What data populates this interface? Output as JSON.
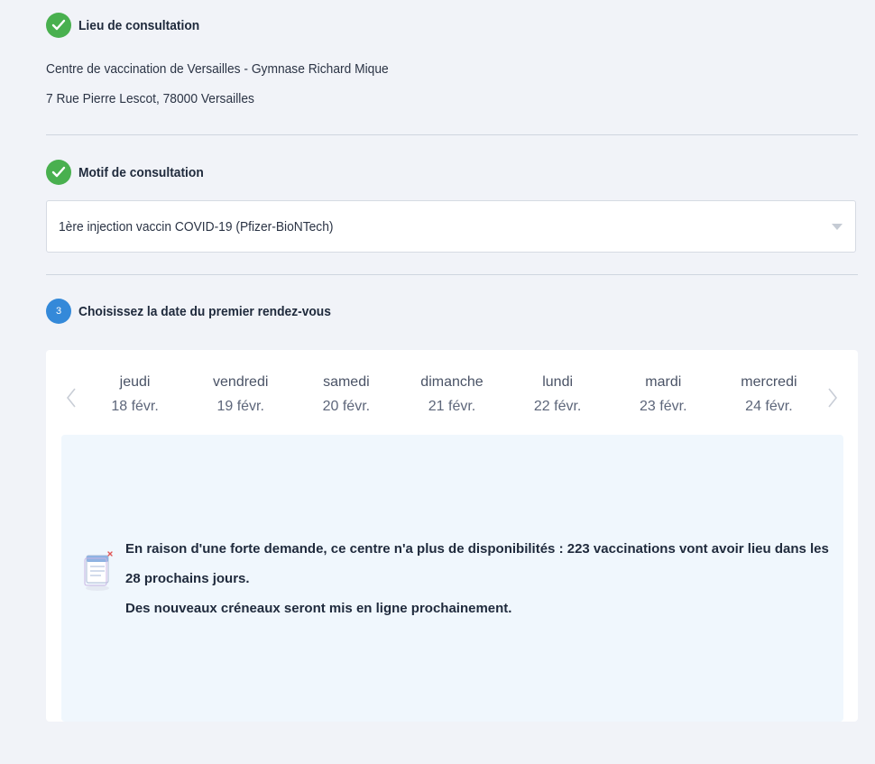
{
  "step1": {
    "title": "Lieu de consultation",
    "center_name": "Centre de vaccination de Versailles - Gymnase Richard Mique",
    "address": "7 Rue Pierre Lescot, 78000 Versailles"
  },
  "step2": {
    "title": "Motif de consultation",
    "selected_reason": "1ère injection vaccin COVID-19 (Pfizer-BioNTech)"
  },
  "step3": {
    "number": "3",
    "title": "Choisissez la date du premier rendez-vous"
  },
  "calendar": {
    "days": [
      {
        "name": "jeudi",
        "date": "18 févr."
      },
      {
        "name": "vendredi",
        "date": "19 févr."
      },
      {
        "name": "samedi",
        "date": "20 févr."
      },
      {
        "name": "dimanche",
        "date": "21 févr."
      },
      {
        "name": "lundi",
        "date": "22 févr."
      },
      {
        "name": "mardi",
        "date": "23 févr."
      },
      {
        "name": "mercredi",
        "date": "24 févr."
      }
    ],
    "notice_line1": "En raison d'une forte demande, ce centre n'a plus de disponibilités : 223 vaccinations vont avoir lieu dans les 28 prochains jours.",
    "notice_line2": "Des nouveaux créneaux seront mis en ligne prochainement.",
    "illustration_icon": "calendar-unavailable-icon"
  },
  "colors": {
    "success": "#49b04f",
    "active_step": "#3489d9",
    "notice_bg": "#f0f7fd"
  }
}
